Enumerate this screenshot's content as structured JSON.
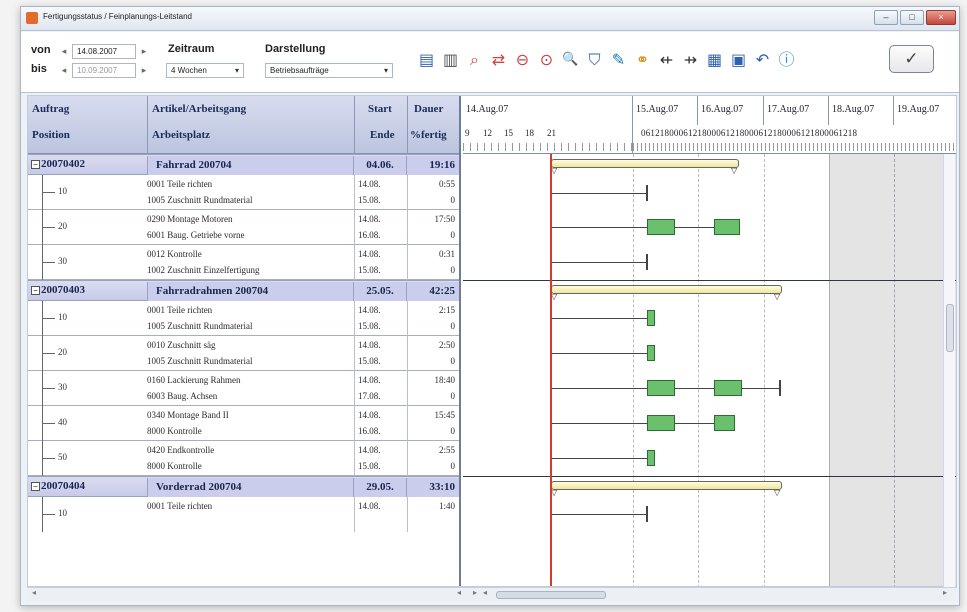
{
  "window": {
    "title": "Fertigungsstatus / Feinplanungs-Leitstand",
    "controls": {
      "minimize": "–",
      "maximize": "□",
      "close": "×"
    }
  },
  "filters": {
    "von_label": "von",
    "bis_label": "bis",
    "von_date": "14.08.2007",
    "bis_date": "10.09.2007",
    "zeitraum_label": "Zeitraum",
    "zeitraum_value": "4 Wochen",
    "darstellung_label": "Darstellung",
    "darstellung_value": "Betriebsaufträge",
    "spin_left": "◂",
    "spin_right": "▸",
    "dropdown_arrow": "▾"
  },
  "toolbar": {
    "icons": [
      "save-icon",
      "list-icon",
      "zoom-in-icon",
      "zoom-range-icon",
      "zoom-out-icon",
      "zoom-fit-icon",
      "search-icon",
      "filter-icon",
      "connect-icon",
      "link-icon",
      "arrow-left-icon",
      "arrow-right-icon",
      "calendar-icon",
      "save-view-icon",
      "undo-icon",
      "info-icon"
    ],
    "icon_glyphs": [
      "▤",
      "▥",
      "⌕",
      "⇄",
      "⊖",
      "⊙",
      "🔍",
      "⛉",
      "✎",
      "⚭",
      "⇷",
      "⇸",
      "▦",
      "▣",
      "↶",
      "ⓘ"
    ],
    "ok_glyph": "✓"
  },
  "grid": {
    "headers": {
      "auftrag": "Auftrag",
      "position": "Position",
      "artikel": "Artikel/Arbeitsgang",
      "arbeitsplatz": "Arbeitsplatz",
      "start": "Start",
      "ende": "Ende",
      "dauer": "Dauer",
      "fertig": "%fertig"
    },
    "orders": [
      {
        "id": "20070402",
        "artikel": "Fahrrad  200704",
        "start": "04.06.",
        "dauer": "19:16",
        "positions": [
          {
            "pos": "10",
            "op": "0001 Teile richten",
            "place": "1005 Zuschnitt Rundmaterial",
            "start": "14.08.",
            "end": "15.08.",
            "dur": "0:55",
            "pct": "0"
          },
          {
            "pos": "20",
            "op": "0290 Montage Motoren",
            "place": "6001 Baug. Getriebe vorne",
            "start": "14.08.",
            "end": "16.08.",
            "dur": "17:50",
            "pct": "0"
          },
          {
            "pos": "30",
            "op": "0012 Kontrolle",
            "place": "1002 Zuschnitt Einzelfertigung",
            "start": "14.08.",
            "end": "15.08.",
            "dur": "0:31",
            "pct": "0"
          }
        ]
      },
      {
        "id": "20070403",
        "artikel": "Fahrradrahmen  200704",
        "start": "25.05.",
        "dauer": "42:25",
        "positions": [
          {
            "pos": "10",
            "op": "0001 Teile richten",
            "place": "1005 Zuschnitt Rundmaterial",
            "start": "14.08.",
            "end": "15.08.",
            "dur": "2:15",
            "pct": "0"
          },
          {
            "pos": "20",
            "op": "0010 Zuschnitt säg",
            "place": "1005 Zuschnitt Rundmaterial",
            "start": "14.08.",
            "end": "15.08.",
            "dur": "2:50",
            "pct": "0"
          },
          {
            "pos": "30",
            "op": "0160 Lackierung Rahmen",
            "place": "6003 Baug. Achsen",
            "start": "14.08.",
            "end": "17.08.",
            "dur": "18:40",
            "pct": "0"
          },
          {
            "pos": "40",
            "op": "0340 Montage Band II",
            "place": "8000 Kontrolle",
            "start": "14.08.",
            "end": "16.08.",
            "dur": "15:45",
            "pct": "0"
          },
          {
            "pos": "50",
            "op": "0420 Endkontrolle",
            "place": "8000 Kontrolle",
            "start": "14.08.",
            "end": "15.08.",
            "dur": "2:55",
            "pct": "0"
          }
        ]
      },
      {
        "id": "20070404",
        "artikel": "Vorderrad  200704",
        "start": "29.05.",
        "dauer": "33:10",
        "positions": [
          {
            "pos": "10",
            "op": "0001 Teile richten",
            "place": "",
            "start": "14.08.",
            "end": "",
            "dur": "1:40",
            "pct": ""
          }
        ]
      }
    ]
  },
  "gantt": {
    "dates": [
      "14.Aug.07",
      "15.Aug.07",
      "16.Aug.07",
      "17.Aug.07",
      "18.Aug.07",
      "19.Aug.07"
    ],
    "hours_first_day": [
      "9",
      "12",
      "15",
      "18",
      "21"
    ],
    "hours_other_days": "0612180006121800061218000612180006121800061218"
  },
  "colors": {
    "gantt_task": "#6bc06e",
    "order_bar": "#f4efb1",
    "now_line": "#d43b2b",
    "header": "#c7cde6"
  }
}
